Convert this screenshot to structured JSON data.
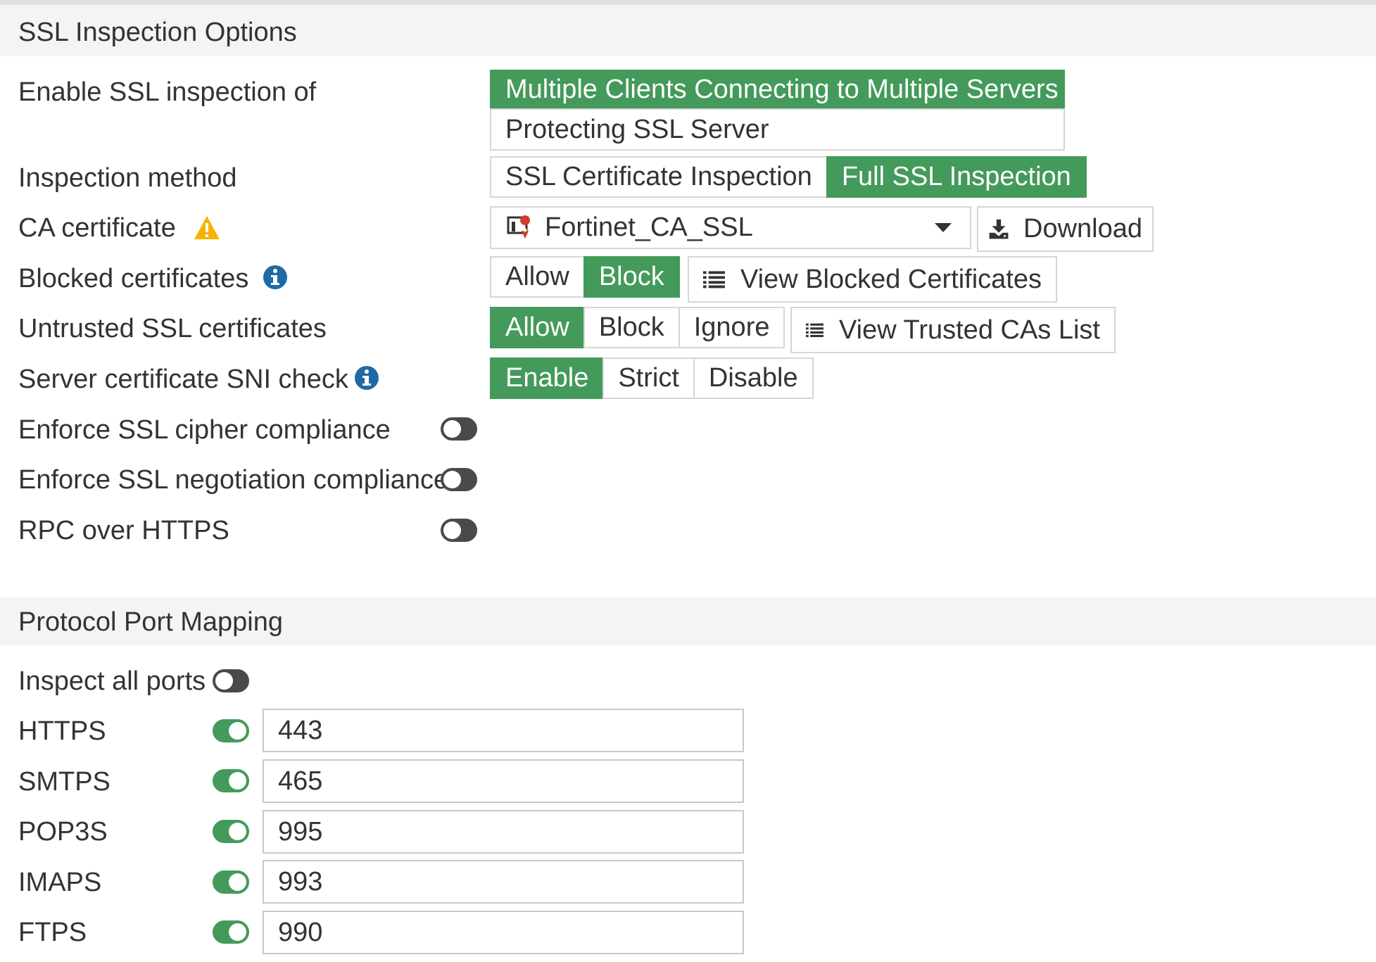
{
  "sections": {
    "ssl": "SSL Inspection Options",
    "ports": "Protocol Port Mapping"
  },
  "ssl": {
    "enable_label": "Enable SSL inspection of",
    "enable_options": [
      "Multiple Clients Connecting to Multiple Servers",
      "Protecting SSL Server"
    ],
    "enable_selected": "Multiple Clients Connecting to Multiple Servers",
    "method_label": "Inspection method",
    "method_options": [
      "SSL Certificate Inspection",
      "Full SSL Inspection"
    ],
    "method_selected": "Full SSL Inspection",
    "ca_label": "CA certificate",
    "ca_value": "Fortinet_CA_SSL",
    "download_label": "Download",
    "blocked_label": "Blocked certificates",
    "blocked_options": [
      "Allow",
      "Block"
    ],
    "blocked_selected": "Block",
    "view_blocked_label": "View Blocked Certificates",
    "untrusted_label": "Untrusted SSL certificates",
    "untrusted_options": [
      "Allow",
      "Block",
      "Ignore"
    ],
    "untrusted_selected": "Allow",
    "view_trusted_label": "View Trusted CAs List",
    "sni_label": "Server certificate SNI check",
    "sni_options": [
      "Enable",
      "Strict",
      "Disable"
    ],
    "sni_selected": "Enable",
    "cipher_label": "Enforce SSL cipher compliance",
    "cipher_enabled": false,
    "negotiation_label": "Enforce SSL negotiation compliance",
    "negotiation_enabled": false,
    "rpc_label": "RPC over HTTPS",
    "rpc_enabled": false
  },
  "ports": {
    "inspect_all_label": "Inspect all ports",
    "inspect_all_enabled": false,
    "protocols": [
      {
        "name": "HTTPS",
        "enabled": true,
        "port": "443"
      },
      {
        "name": "SMTPS",
        "enabled": true,
        "port": "465"
      },
      {
        "name": "POP3S",
        "enabled": true,
        "port": "995"
      },
      {
        "name": "IMAPS",
        "enabled": true,
        "port": "993"
      },
      {
        "name": "FTPS",
        "enabled": true,
        "port": "990"
      }
    ]
  },
  "colors": {
    "accent": "#439a5a",
    "info": "#1f6aa5",
    "warning": "#f5b301"
  }
}
